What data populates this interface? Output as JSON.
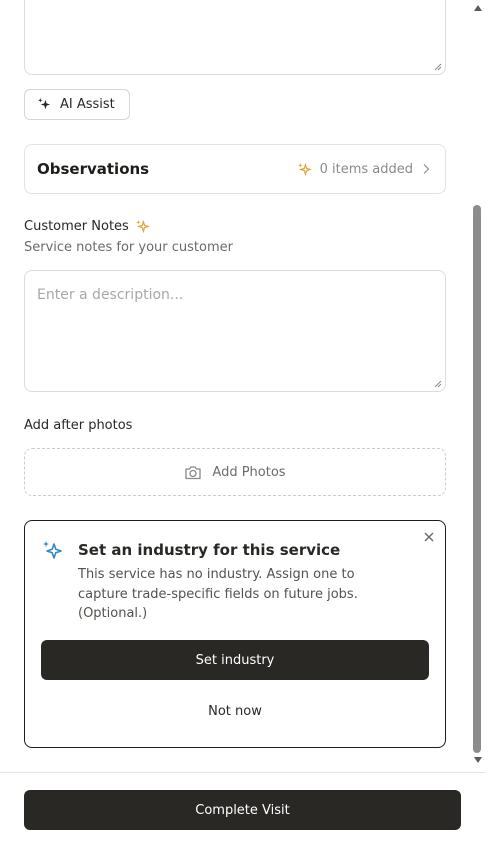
{
  "ai_assist": {
    "label": "AI Assist",
    "icon": "sparkle-icon"
  },
  "observations": {
    "title": "Observations",
    "count_text": "0 items added",
    "icon": "sparkle-icon"
  },
  "customer_notes": {
    "label": "Customer Notes",
    "help": "Service notes for your customer",
    "placeholder": "Enter a description..."
  },
  "photos": {
    "label": "Add after photos",
    "button_label": "Add Photos",
    "icon": "camera-icon"
  },
  "industry_prompt": {
    "title": "Set an industry for this service",
    "body": "This service has no industry. Assign one to capture trade-specific fields on future jobs. (Optional.)",
    "primary_label": "Set industry",
    "secondary_label": "Not now"
  },
  "footer": {
    "complete_label": "Complete Visit"
  },
  "colors": {
    "accent_sparkle": "#e8a23a",
    "info_sparkle": "#2e8bc0",
    "primary_button": "#2a2825"
  }
}
